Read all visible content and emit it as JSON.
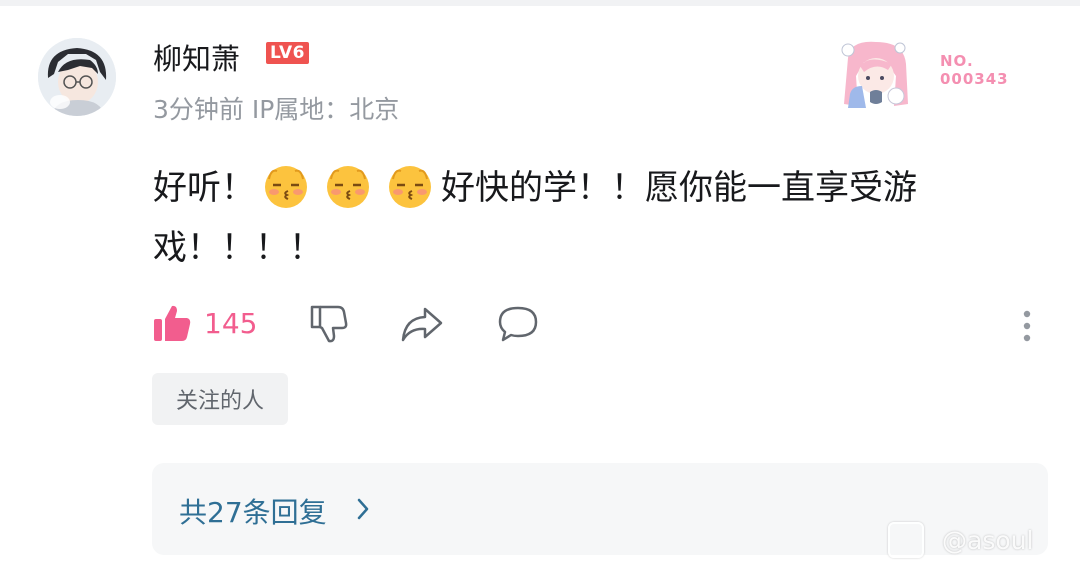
{
  "comment": {
    "author": "柳知萧",
    "level": "LV6",
    "meta": "3分钟前 IP属地：北京",
    "badge": {
      "no_label": "NO.",
      "number": "000343"
    },
    "text_prefix": "好听！",
    "text_suffix": "好快的学！！愿你能一直享受游戏！！！！",
    "emojis": [
      "shy-kiss-emoji",
      "shy-kiss-emoji",
      "shy-kiss-emoji"
    ],
    "likes": "145",
    "tag": "关注的人",
    "replies": "共27条回复",
    "watermark": "@asoul"
  },
  "colors": {
    "accent_pink": "#f25d8e",
    "level_red": "#ef5350",
    "reply_link": "#2f6f95"
  }
}
